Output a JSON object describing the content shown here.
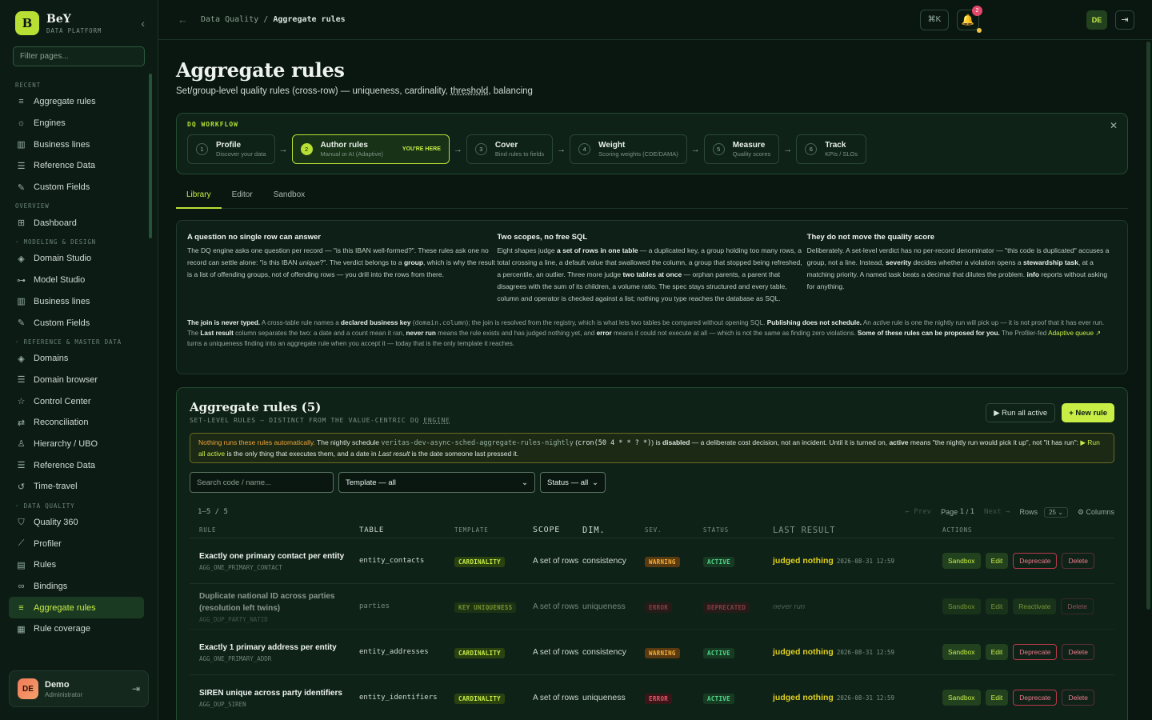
{
  "brand": {
    "letter": "B",
    "name": "BeY",
    "sub": "DATA PLATFORM"
  },
  "sidebar": {
    "filter_placeholder": "Filter pages...",
    "sections": [
      {
        "title": "RECENT",
        "items": [
          {
            "label": "Aggregate rules",
            "icon": "filter-icon"
          },
          {
            "label": "Engines",
            "icon": "sun-icon"
          },
          {
            "label": "Business lines",
            "icon": "bar-chart-icon"
          },
          {
            "label": "Reference Data",
            "icon": "list-icon"
          },
          {
            "label": "Custom Fields",
            "icon": "pen-icon"
          }
        ]
      },
      {
        "title": "OVERVIEW",
        "items": [
          {
            "label": "Dashboard",
            "icon": "grid-icon"
          }
        ]
      },
      {
        "title": "◦ MODELING & DESIGN",
        "items": [
          {
            "label": "Domain Studio",
            "icon": "layers-icon"
          },
          {
            "label": "Model Studio",
            "icon": "hierarchy-icon"
          },
          {
            "label": "Business lines",
            "icon": "bar-chart-icon"
          },
          {
            "label": "Custom Fields",
            "icon": "pen-icon"
          }
        ]
      },
      {
        "title": "◦ REFERENCE & MASTER DATA",
        "items": [
          {
            "label": "Domains",
            "icon": "layers-icon"
          },
          {
            "label": "Domain browser",
            "icon": "list-icon"
          },
          {
            "label": "Control Center",
            "icon": "star-icon"
          },
          {
            "label": "Reconciliation",
            "icon": "swap-icon"
          },
          {
            "label": "Hierarchy / UBO",
            "icon": "tree-icon"
          },
          {
            "label": "Reference Data",
            "icon": "list-icon"
          },
          {
            "label": "Time-travel",
            "icon": "history-icon"
          }
        ]
      },
      {
        "title": "◦ DATA QUALITY",
        "items": [
          {
            "label": "Quality 360",
            "icon": "shield-check-icon"
          },
          {
            "label": "Profiler",
            "icon": "line-chart-icon"
          },
          {
            "label": "Rules",
            "icon": "clipboard-icon"
          },
          {
            "label": "Bindings",
            "icon": "link-icon"
          },
          {
            "label": "Aggregate rules",
            "icon": "filter-icon",
            "active": true
          },
          {
            "label": "Rule coverage",
            "icon": "grid-small-icon"
          }
        ]
      }
    ],
    "user": {
      "initials": "DE",
      "name": "Demo",
      "role": "Administrator"
    }
  },
  "topbar": {
    "crumb_parent": "Data Quality",
    "crumb_sep": "/",
    "crumb_current": "Aggregate rules",
    "shortcut": "⌘K",
    "notifications": "2",
    "user_initials": "DE"
  },
  "page": {
    "title": "Aggregate rules",
    "subtitle_pre": "Set/group-level quality rules (cross-row) — uniqueness, cardinality, ",
    "subtitle_term": "threshold",
    "subtitle_post": ", balancing"
  },
  "workflow": {
    "title": "DQ WORKFLOW",
    "here": "YOU'RE HERE",
    "steps": [
      {
        "n": "1",
        "title": "Profile",
        "desc": "Discover your data"
      },
      {
        "n": "2",
        "title": "Author rules",
        "desc": "Manual or AI (Adaptive)",
        "current": true
      },
      {
        "n": "3",
        "title": "Cover",
        "desc": "Bind rules to fields"
      },
      {
        "n": "4",
        "title": "Weight",
        "desc": "Scoring weights (CDE/DAMA)"
      },
      {
        "n": "5",
        "title": "Measure",
        "desc": "Quality scores"
      },
      {
        "n": "6",
        "title": "Track",
        "desc": "KPIs / SLOs"
      }
    ]
  },
  "tabs": [
    "Library",
    "Editor",
    "Sandbox"
  ],
  "explain": {
    "c1_title": "A question no single row can answer",
    "c2_title": "Two scopes, no free SQL",
    "c3_title": "They do not move the quality score"
  },
  "panel": {
    "title": "Aggregate rules (5)",
    "sub_pre": "SET-LEVEL RULES — DISTINCT FROM THE VALUE-CENTRIC DQ ",
    "sub_term": "ENGINE",
    "run_all": "▶ Run all active",
    "new_rule": "+ New rule",
    "search_placeholder": "Search code / name...",
    "template_filter": "Template — all",
    "status_filter": "Status — all",
    "count": "1–5 / 5",
    "prev": "← Prev",
    "page_label": "Page",
    "page_num": "1",
    "page_of": "/",
    "page_total": "1",
    "next": "Next →",
    "rows_label": "Rows",
    "rows_value": "25",
    "columns": "⚙ Columns",
    "headers": [
      "RULE",
      "TABLE",
      "TEMPLATE",
      "SCOPE",
      "DIM.",
      "SEV.",
      "STATUS",
      "LAST RESULT",
      "ACTIONS"
    ]
  },
  "rows": [
    {
      "name": "Exactly one primary contact per entity",
      "code": "AGG_ONE_PRIMARY_CONTACT",
      "table": "entity_contacts",
      "template": "CARDINALITY",
      "scope": "A set of rows",
      "dim": "consistency",
      "sev": "WARNING",
      "status": "ACTIVE",
      "result": "judged nothing",
      "ts": "2026-08-31 12:59",
      "a3": "Deprecate"
    },
    {
      "name": "Duplicate national ID across parties (resolution left twins)",
      "code": "AGG_DUP_PARTY_NATID",
      "table": "parties",
      "template": "KEY UNIQUENESS",
      "scope": "A set of rows",
      "dim": "uniqueness",
      "sev": "ERROR",
      "status": "DEPRECATED",
      "result": "never run",
      "ts": "",
      "a3": "Reactivate"
    },
    {
      "name": "Exactly 1 primary address per entity",
      "code": "AGG_ONE_PRIMARY_ADDR",
      "table": "entity_addresses",
      "template": "CARDINALITY",
      "scope": "A set of rows",
      "dim": "consistency",
      "sev": "WARNING",
      "status": "ACTIVE",
      "result": "judged nothing",
      "ts": "2026-08-31 12:59",
      "a3": "Deprecate"
    },
    {
      "name": "SIREN unique across party identifiers",
      "code": "AGG_DUP_SIREN",
      "table": "entity_identifiers",
      "template": "CARDINALITY",
      "scope": "A set of rows",
      "dim": "uniqueness",
      "sev": "ERROR",
      "status": "ACTIVE",
      "result": "judged nothing",
      "ts": "2026-08-31 12:59",
      "a3": "Deprecate"
    }
  ],
  "actions": {
    "sandbox": "Sandbox",
    "edit": "Edit",
    "delete": "Delete"
  }
}
